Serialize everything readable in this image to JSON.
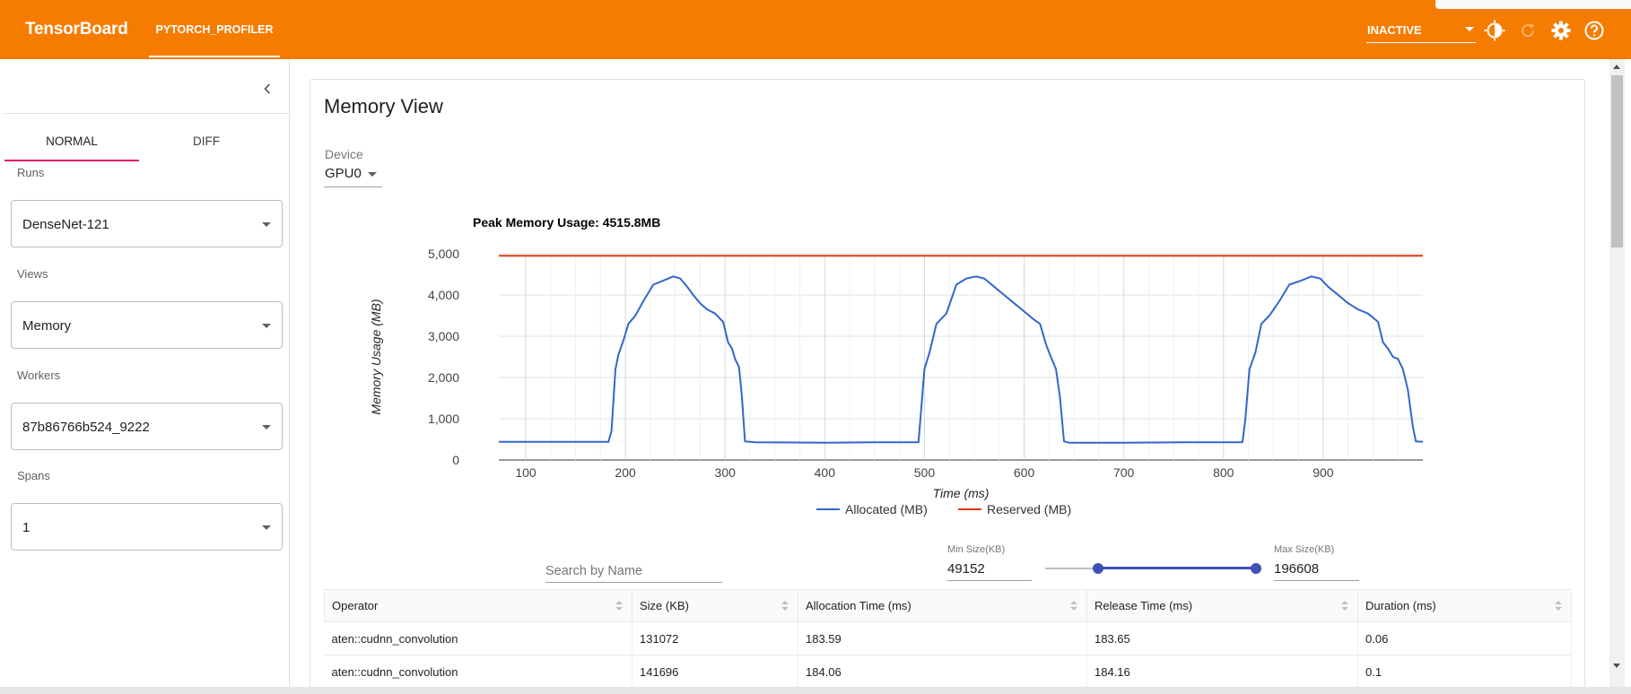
{
  "app": {
    "brand": "TensorBoard",
    "plugin_tab": "PYTORCH_PROFILER",
    "status_value": "INACTIVE",
    "icons": [
      "theme-toggle-icon",
      "refresh-icon",
      "settings-icon",
      "help-icon",
      "chevron-left-icon"
    ],
    "accent_color": "#f57c00"
  },
  "sidebar": {
    "tabs": [
      "NORMAL",
      "DIFF"
    ],
    "active_tab": "NORMAL",
    "runs_label": "Runs",
    "runs_value": "DenseNet-121",
    "views_label": "Views",
    "views_value": "Memory",
    "workers_label": "Workers",
    "workers_value": "87b86766b524_9222",
    "spans_label": "Spans",
    "spans_value": "1"
  },
  "main": {
    "title": "Memory View",
    "device_label": "Device",
    "device_value": "GPU0"
  },
  "chart_data": {
    "type": "line",
    "title": "Peak Memory Usage: 4515.8MB",
    "xlabel": "Time (ms)",
    "ylabel": "Memory Usage (MB)",
    "xlim": [
      73,
      1000
    ],
    "ylim": [
      0,
      5000
    ],
    "xticks": [
      100,
      200,
      300,
      400,
      500,
      600,
      700,
      800,
      900
    ],
    "yticks": [
      0,
      1000,
      2000,
      3000,
      4000,
      5000
    ],
    "ytick_labels": [
      "0",
      "1,000",
      "2,000",
      "3,000",
      "4,000",
      "5,000"
    ],
    "grid": true,
    "legend": "bottom",
    "series": [
      {
        "name": "Allocated (MB)",
        "color": "#3366cc",
        "x": [
          73,
          120,
          183,
          186,
          190,
          193,
          198,
          203,
          210,
          218,
          228,
          238,
          248,
          255,
          262,
          268,
          275,
          282,
          290,
          298,
          303,
          307,
          310,
          314,
          317,
          320,
          330,
          400,
          450,
          494,
          497,
          500,
          505,
          512,
          522,
          532,
          542,
          552,
          560,
          570,
          580,
          590,
          600,
          610,
          616,
          622,
          626,
          632,
          636,
          640,
          645,
          700,
          760,
          819,
          822,
          826,
          832,
          838,
          846,
          856,
          866,
          878,
          888,
          897,
          905,
          915,
          925,
          935,
          945,
          955,
          960,
          965,
          970,
          975,
          980,
          985,
          990,
          993,
          1000
        ],
        "y": [
          440,
          440,
          440,
          700,
          2200,
          2550,
          2900,
          3300,
          3500,
          3850,
          4250,
          4350,
          4450,
          4400,
          4200,
          4000,
          3800,
          3650,
          3550,
          3350,
          2850,
          2700,
          2450,
          2250,
          1500,
          450,
          430,
          420,
          430,
          430,
          1300,
          2200,
          2600,
          3300,
          3550,
          4250,
          4400,
          4450,
          4400,
          4200,
          4000,
          3800,
          3600,
          3400,
          3300,
          2800,
          2550,
          2200,
          1500,
          450,
          420,
          420,
          430,
          430,
          1000,
          2200,
          2600,
          3300,
          3500,
          3850,
          4250,
          4350,
          4450,
          4400,
          4200,
          4000,
          3800,
          3650,
          3550,
          3350,
          2850,
          2700,
          2500,
          2450,
          2200,
          1700,
          800,
          450,
          440
        ]
      },
      {
        "name": "Reserved (MB)",
        "color": "#dc3912",
        "x": [
          73,
          1000
        ],
        "y": [
          4950,
          4950
        ]
      }
    ]
  },
  "filters": {
    "search_placeholder": "Search by Name",
    "min_label": "Min Size(KB)",
    "min_value": "49152",
    "max_label": "Max Size(KB)",
    "max_value": "196608",
    "slider_min_fraction": 0.25,
    "slider_max_fraction": 1.0
  },
  "table": {
    "columns": [
      "Operator",
      "Size (KB)",
      "Allocation Time (ms)",
      "Release Time (ms)",
      "Duration (ms)"
    ],
    "rows": [
      [
        "aten::cudnn_convolution",
        "131072",
        "183.59",
        "183.65",
        "0.06"
      ],
      [
        "aten::cudnn_convolution",
        "141696",
        "184.06",
        "184.16",
        "0.1"
      ]
    ]
  }
}
